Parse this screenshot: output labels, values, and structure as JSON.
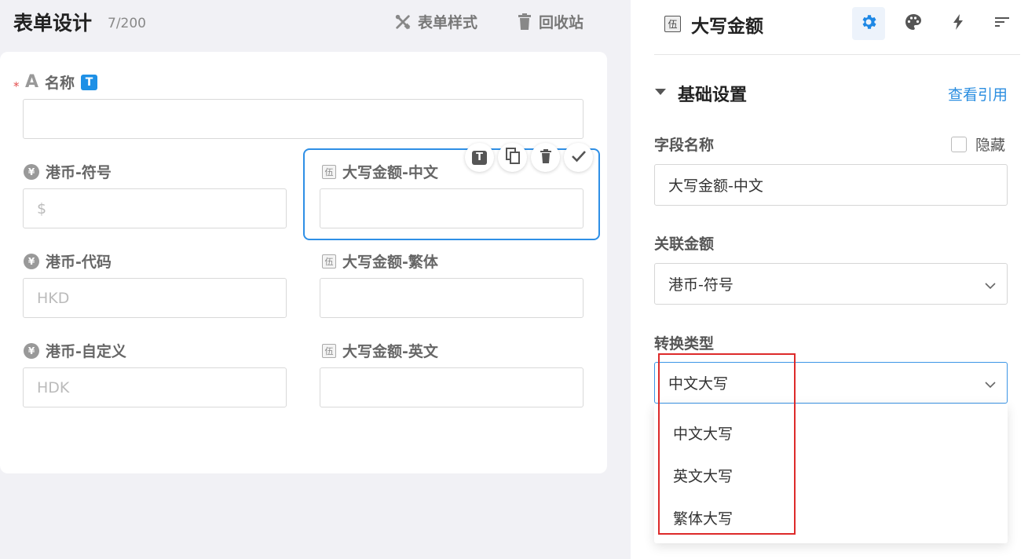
{
  "header": {
    "title": "表单设计",
    "count": "7/200",
    "style_btn": "表单样式",
    "recycle_btn": "回收站"
  },
  "form": {
    "name_field": {
      "label": "名称",
      "badge": "T",
      "required": true,
      "icon": "text-A-icon",
      "value": ""
    },
    "rows": [
      {
        "left": {
          "label": "港币-符号",
          "icon": "yen-icon",
          "placeholder": "$"
        },
        "right": {
          "label": "大写金额-中文",
          "icon": "wu-icon",
          "placeholder": ""
        }
      },
      {
        "left": {
          "label": "港币-代码",
          "icon": "yen-icon",
          "placeholder": "HKD"
        },
        "right": {
          "label": "大写金额-繁体",
          "icon": "wu-icon",
          "placeholder": ""
        }
      },
      {
        "left": {
          "label": "港币-自定义",
          "icon": "yen-icon",
          "placeholder": "HDK"
        },
        "right": {
          "label": "大写金额-英文",
          "icon": "wu-icon",
          "placeholder": ""
        }
      }
    ],
    "wu_glyph": "伍",
    "yen_glyph": "¥",
    "text_glyph": "A",
    "field_actions": [
      "title-toggle-icon",
      "copy-icon",
      "delete-icon",
      "check-icon"
    ]
  },
  "panel": {
    "title": "大写金额",
    "type_glyph": "伍",
    "tabs": [
      "settings-gear-icon",
      "palette-icon",
      "lightning-icon",
      "sort-lines-icon"
    ],
    "active_tab": "settings-gear-icon",
    "section_title": "基础设置",
    "section_link": "查看引用",
    "field_name_label": "字段名称",
    "hide_label": "隐藏",
    "hide_checked": false,
    "field_name_value": "大写金额-中文",
    "linked_label": "关联金额",
    "linked_value": "港币-符号",
    "convert_label": "转换类型",
    "convert_value": "中文大写",
    "options": [
      "中文大写",
      "英文大写",
      "繁体大写"
    ]
  },
  "colors": {
    "accent": "#2e8fe6",
    "badge_blue": "#1e90e6",
    "highlight_red": "#dd2a2a",
    "required_red": "#e34d4d",
    "link_blue": "#2b8ee0"
  }
}
